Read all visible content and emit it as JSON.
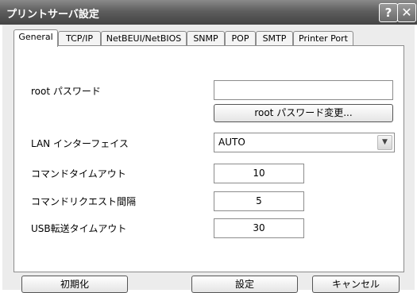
{
  "window": {
    "title": "プリントサーバ設定",
    "help_glyph": "?",
    "close_glyph": "✕"
  },
  "tabs": [
    {
      "label": "General",
      "active": true
    },
    {
      "label": "TCP/IP"
    },
    {
      "label": "NetBEUI/NetBIOS"
    },
    {
      "label": "SNMP"
    },
    {
      "label": "POP"
    },
    {
      "label": "SMTP"
    },
    {
      "label": "Printer Port"
    }
  ],
  "general": {
    "root_password_label": "root パスワード",
    "root_password_value": "",
    "change_password_button": "root パスワード変更...",
    "lan_interface_label": "LAN インターフェイス",
    "lan_interface_value": "AUTO",
    "command_timeout_label": "コマンドタイムアウト",
    "command_timeout_value": "10",
    "command_request_interval_label": "コマンドリクエスト間隔",
    "command_request_interval_value": "5",
    "usb_timeout_label": "USB転送タイムアウト",
    "usb_timeout_value": "30"
  },
  "footer": {
    "init_button": "初期化",
    "ok_button": "設定",
    "cancel_button": "キャンセル"
  }
}
